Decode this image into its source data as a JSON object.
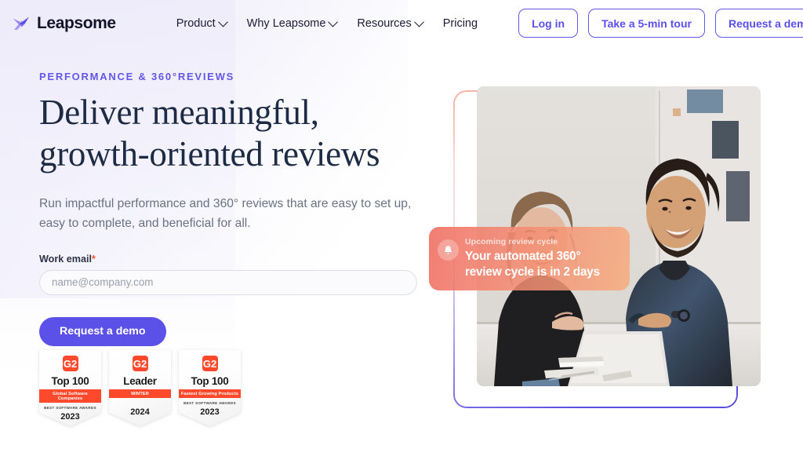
{
  "brand": {
    "name": "Leapsome",
    "logo_icon": "leapsome-bird-logo",
    "accent_purple": "#5b51e8",
    "accent_coral": "#ff492c",
    "headline_navy": "#1d2b44"
  },
  "nav": {
    "links": [
      {
        "label": "Product",
        "has_chevron": true
      },
      {
        "label": "Why Leapsome",
        "has_chevron": true
      },
      {
        "label": "Resources",
        "has_chevron": true
      },
      {
        "label": "Pricing",
        "has_chevron": false
      }
    ],
    "buttons": [
      {
        "label": "Log in"
      },
      {
        "label": "Take a 5-min tour"
      },
      {
        "label": "Request a demo"
      }
    ]
  },
  "hero": {
    "eyebrow": "PERFORMANCE & 360°REVIEWS",
    "headline_line1": "Deliver meaningful,",
    "headline_line2": "growth-oriented reviews",
    "subhead": "Run impactful performance and 360° reviews that are easy to set up, easy to complete, and beneficial for all.",
    "form": {
      "label": "Work email",
      "required_mark": "*",
      "placeholder": "name@company.com",
      "value": "",
      "submit_label": "Request a demo"
    }
  },
  "badges": [
    {
      "logo": "G2",
      "title": "Top 100",
      "ribbon": "Global Software Companies",
      "sub": "BEST SOFTWARE AWARDS",
      "year": "2023"
    },
    {
      "logo": "G2",
      "title": "Leader",
      "ribbon": "WINTER",
      "sub": "",
      "year": "2024"
    },
    {
      "logo": "G2",
      "title": "Top 100",
      "ribbon": "Fastest Growing Products",
      "sub": "BEST SOFTWARE AWARDS",
      "year": "2023"
    }
  ],
  "hero_image": {
    "alt": "Two colleagues smiling at a desk with a laptop during a review conversation",
    "notification": {
      "icon": "bell-icon",
      "label": "Upcoming review cycle",
      "title_line1": "Your automated 360°",
      "title_line2": "review cycle is in 2 days"
    }
  }
}
